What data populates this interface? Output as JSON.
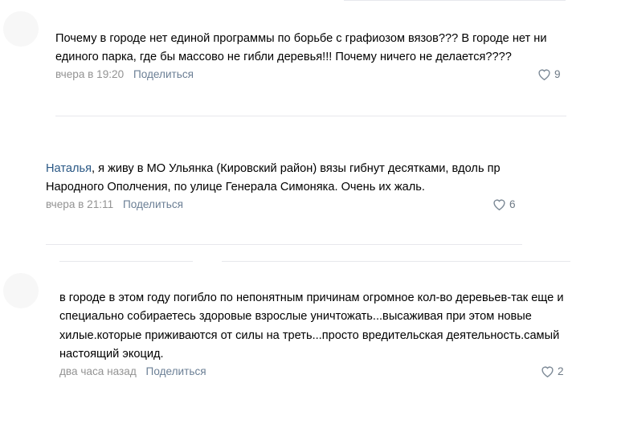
{
  "comments": [
    {
      "author": "",
      "text": "Почему в городе нет единой программы по борьбе с графиозом вязов??? В городе нет ни единого парка, где бы массово не гибли деревья!!! Почему ничего не делается????",
      "time": "вчера в 19:20",
      "share": "Поделиться",
      "likes": "9"
    },
    {
      "author": "Наталья",
      "text": ", я живу в МО Ульянка (Кировский район) вязы гибнут десятками, вдоль пр Народного Ополчения, по улице Генерала Симоняка. Очень их жаль.",
      "time": "вчера в 21:11",
      "share": "Поделиться",
      "likes": "6"
    },
    {
      "author": "",
      "text": "в городе в этом году погибло по непонятным причинам огромное кол-во деревьев-так еще и специально собираетесь здоровые взрослые уничтожать...высаживая при этом новые хилые.которые приживаются от силы на треть...просто вредительская деятельность.самый настоящий экоцид.",
      "time": "два часа назад",
      "share": "Поделиться",
      "likes": "2"
    }
  ],
  "icons": {
    "like": "heart-outline-icon"
  },
  "colors": {
    "author_link": "#2a5885",
    "meta": "#939393",
    "divider": "#e7e8ec"
  }
}
